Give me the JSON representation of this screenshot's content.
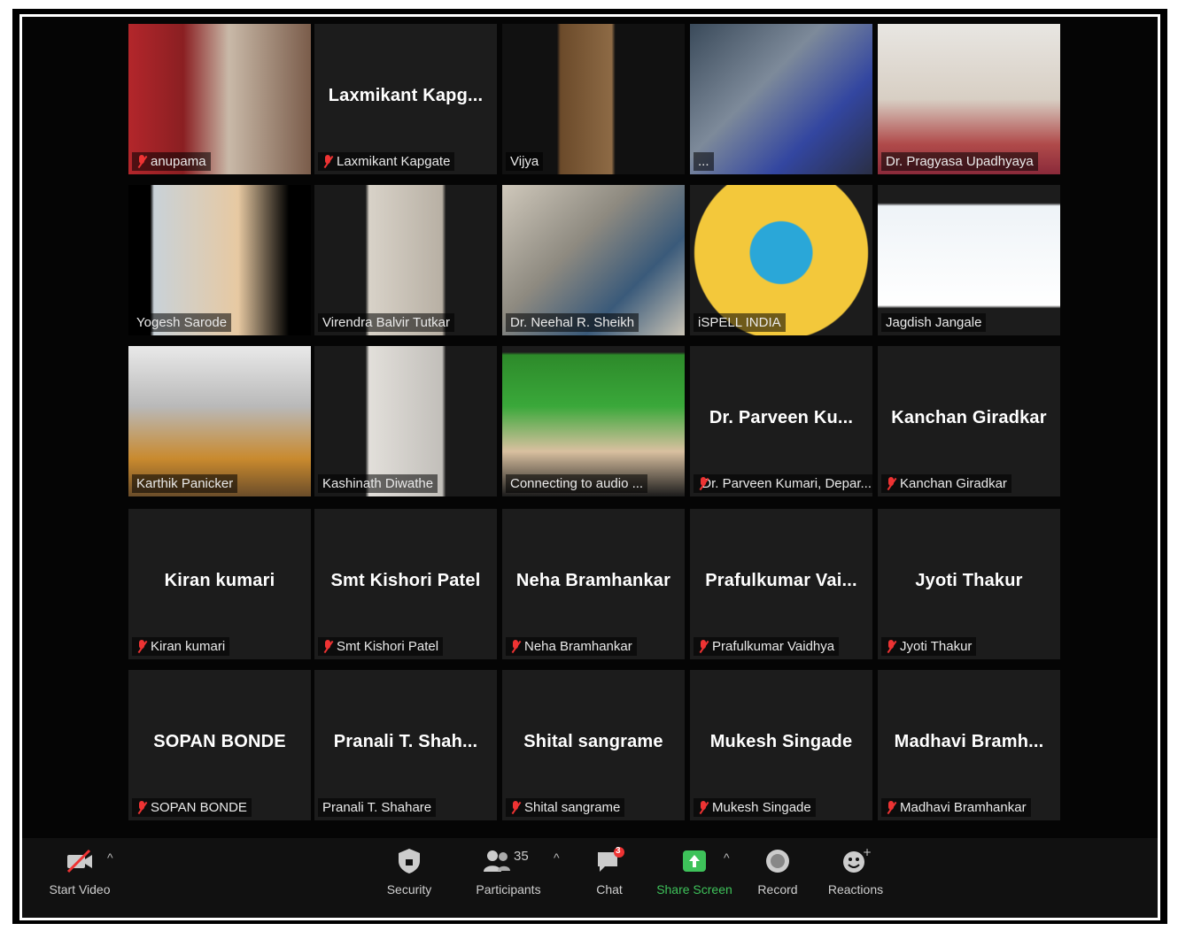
{
  "tiles": [
    {
      "label": "anupama",
      "muted": true,
      "video": "v1"
    },
    {
      "label": "Laxmikant Kapgate",
      "center": "Laxmikant Kapg...",
      "muted": true
    },
    {
      "label": "Vijya",
      "video": "v3"
    },
    {
      "label": "...",
      "video": "v4"
    },
    {
      "label": "Dr. Pragyasa Upadhyaya",
      "video": "v5"
    },
    {
      "label": "Yogesh Sarode",
      "video": "v6",
      "active": true
    },
    {
      "label": "Virendra Balvir Tutkar",
      "video": "v7"
    },
    {
      "label": "Dr. Neehal R. Sheikh",
      "video": "v8"
    },
    {
      "label": "iSPELL INDIA",
      "video": "v9"
    },
    {
      "label": "Jagdish Jangale",
      "video": "v10"
    },
    {
      "label": "Karthik Panicker",
      "video": "v11"
    },
    {
      "label": "Kashinath Diwathe",
      "video": "v12"
    },
    {
      "label": "Connecting to audio ...",
      "video": "v13"
    },
    {
      "label": "Dr. Parveen Kumari, Depar...",
      "center": "Dr. Parveen Ku...",
      "muted": true
    },
    {
      "label": "Kanchan Giradkar",
      "center": "Kanchan Giradkar",
      "muted": true
    },
    {
      "label": "Kiran kumari",
      "center": "Kiran kumari",
      "muted": true
    },
    {
      "label": "Smt Kishori Patel",
      "center": "Smt Kishori Patel",
      "muted": true
    },
    {
      "label": "Neha Bramhankar",
      "center": "Neha Bramhankar",
      "muted": true
    },
    {
      "label": "Prafulkumar Vaidhya",
      "center": "Prafulkumar Vai...",
      "muted": true
    },
    {
      "label": "Jyoti Thakur",
      "center": "Jyoti Thakur",
      "muted": true
    },
    {
      "label": "SOPAN BONDE",
      "center": "SOPAN BONDE",
      "muted": true
    },
    {
      "label": "Pranali T. Shahare",
      "center": "Pranali T. Shah..."
    },
    {
      "label": "Shital sangrame",
      "center": "Shital sangrame",
      "muted": true
    },
    {
      "label": "Mukesh Singade",
      "center": "Mukesh Singade",
      "muted": true
    },
    {
      "label": "Madhavi Bramhankar",
      "center": "Madhavi Bramh...",
      "muted": true
    }
  ],
  "toolbar": {
    "start_video": "Start Video",
    "security": "Security",
    "participants": "Participants",
    "participants_count": "35",
    "chat": "Chat",
    "chat_badge": "3",
    "share_screen": "Share Screen",
    "record": "Record",
    "reactions": "Reactions"
  },
  "colors": {
    "share_green": "#3ec25a",
    "active_border": "#e5e56a",
    "muted_red": "#e33333"
  }
}
